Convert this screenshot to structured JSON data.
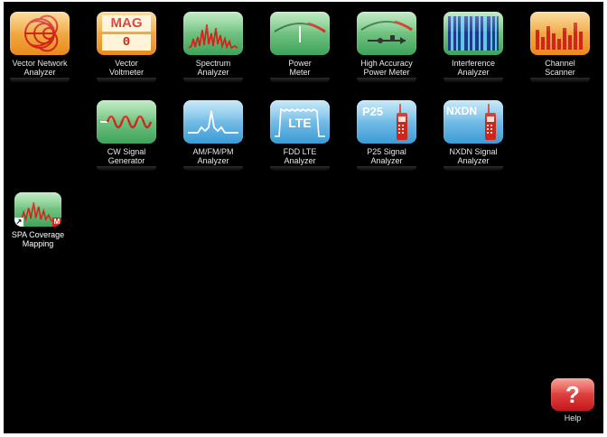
{
  "apps_row1": [
    {
      "label": "Vector Network\nAnalyzer",
      "icon": "smith-chart-icon"
    },
    {
      "label": "Vector\nVoltmeter",
      "icon": "mag-readout-icon",
      "text_top": "MAG",
      "text_bottom": "0"
    },
    {
      "label": "Spectrum\nAnalyzer",
      "icon": "spectrum-icon"
    },
    {
      "label": "Power\nMeter",
      "icon": "power-gauge-icon"
    },
    {
      "label": "High Accuracy\nPower Meter",
      "icon": "usb-power-sensor-icon"
    },
    {
      "label": "Interference\nAnalyzer",
      "icon": "spectrogram-icon"
    },
    {
      "label": "Channel\nScanner",
      "icon": "channel-bars-icon"
    }
  ],
  "apps_row2": [
    {
      "label": "CW Signal\nGenerator",
      "icon": "sine-wave-icon"
    },
    {
      "label": "AM/FM/PM\nAnalyzer",
      "icon": "modulation-icon"
    },
    {
      "label": "FDD LTE\nAnalyzer",
      "icon": "lte-icon",
      "text": "LTE"
    },
    {
      "label": "P25 Signal\nAnalyzer",
      "icon": "p25-radio-icon",
      "text": "P25"
    },
    {
      "label": "NXDN Signal\nAnalyzer",
      "icon": "nxdn-radio-icon",
      "text": "NXDN"
    }
  ],
  "shortcut": {
    "label": "SPA Coverage\nMapping",
    "icon": "spectrum-shortcut-icon",
    "badge": "M"
  },
  "help": {
    "label": "Help",
    "symbol": "?"
  },
  "colors": {
    "orange": "#e98a1c",
    "green": "#3ea35a",
    "blue": "#3b9bd6",
    "red": "#c4161c"
  }
}
